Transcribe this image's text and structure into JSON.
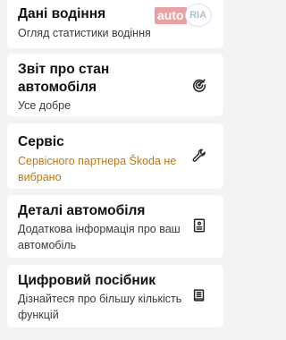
{
  "watermark": {
    "left": "auto",
    "right": "RIA",
    "suffix": ".com"
  },
  "cards": [
    {
      "title": "Дані водіння",
      "subtitle": "Огляд статистики водіння",
      "icon": "none"
    },
    {
      "title": "Звіт про стан автомобіля",
      "subtitle": "Усе добре",
      "icon": "gauge-icon"
    },
    {
      "title": "Сервіс",
      "subtitle": "Сервісного партнера Škoda не вибрано",
      "icon": "wrench-icon",
      "subtitle_color": "#c0760b"
    },
    {
      "title": "Деталі автомобіля",
      "subtitle": "Додаткова інформація про ваш автомобіль",
      "icon": "document-icon"
    },
    {
      "title": "Цифровий посібник",
      "subtitle": "Дізнайтеся про більшу кількість функцій",
      "icon": "book-icon"
    }
  ]
}
